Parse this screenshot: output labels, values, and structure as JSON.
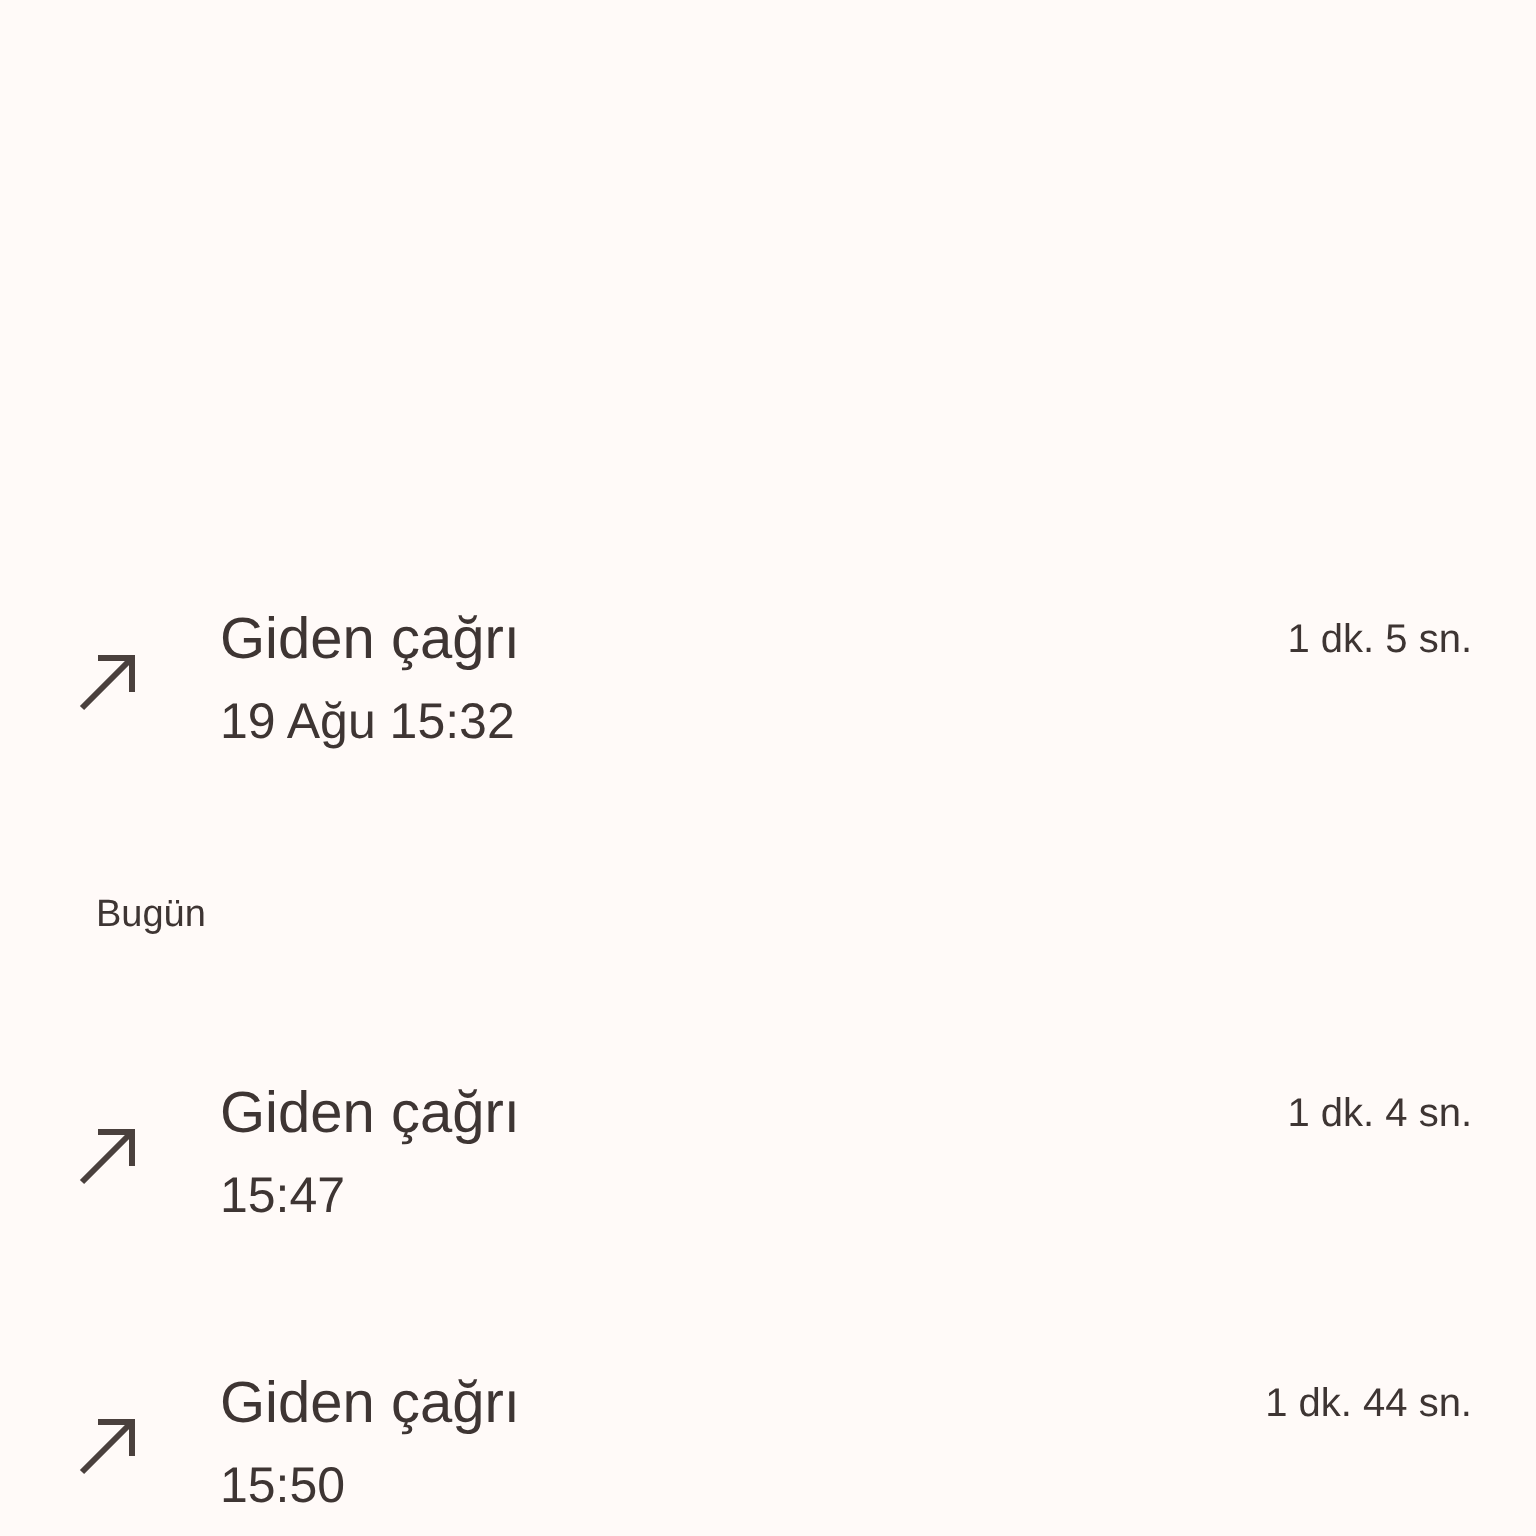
{
  "sections": [
    {
      "calls": [
        {
          "kind": "outgoing",
          "title": "Giden çağrı",
          "time": "19 Ağu 15:32",
          "duration": "1 dk. 5 sn."
        }
      ]
    },
    {
      "heading": "Bugün",
      "calls": [
        {
          "kind": "outgoing",
          "title": "Giden çağrı",
          "time": "15:47",
          "duration": "1 dk. 4 sn."
        },
        {
          "kind": "outgoing",
          "title": "Giden çağrı",
          "time": "15:50",
          "duration": "1 dk. 44 sn."
        }
      ]
    }
  ]
}
